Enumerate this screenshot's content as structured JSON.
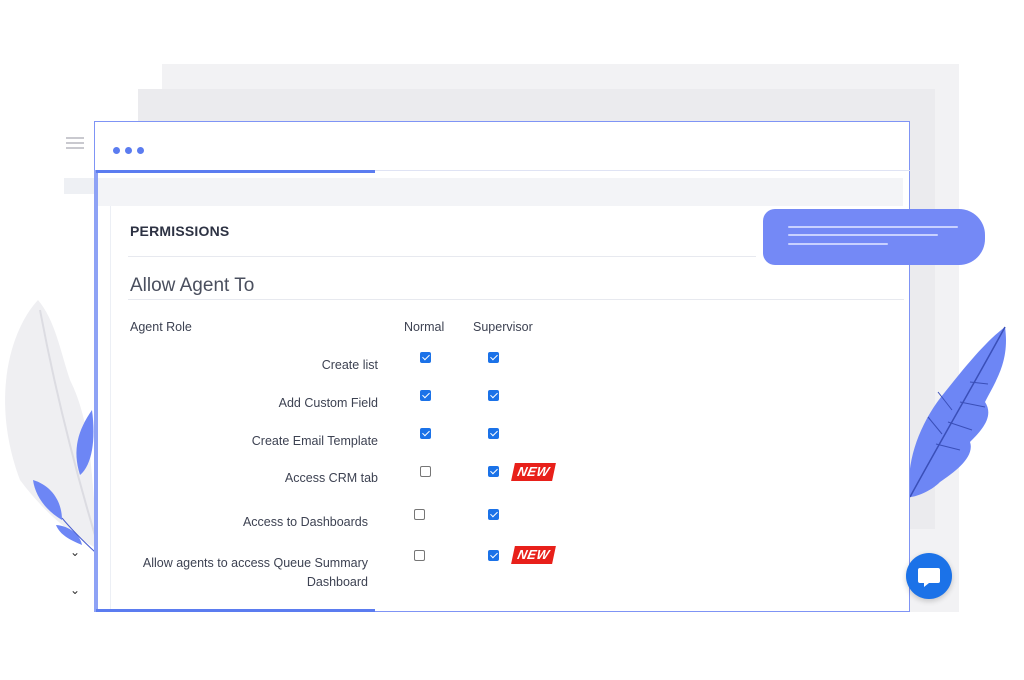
{
  "window": {
    "menu_icon": "ellipsis-icon"
  },
  "sidebar": {
    "menu_icon": "hamburger-icon",
    "chevrons": [
      "⌄",
      "⌄"
    ]
  },
  "section": {
    "title": "PERMISSIONS",
    "subtitle": "Allow Agent To"
  },
  "table": {
    "headers": {
      "role": "Agent Role",
      "normal": "Normal",
      "supervisor": "Supervisor"
    },
    "rows": [
      {
        "label": "Create list",
        "normal": true,
        "supervisor": true,
        "badge": ""
      },
      {
        "label": "Add Custom Field",
        "normal": true,
        "supervisor": true,
        "badge": ""
      },
      {
        "label": "Create Email Template",
        "normal": true,
        "supervisor": true,
        "badge": ""
      },
      {
        "label": "Access CRM tab",
        "normal": false,
        "supervisor": true,
        "badge": "NEW"
      },
      {
        "label": "Access to Dashboards",
        "normal": false,
        "supervisor": true,
        "badge": ""
      },
      {
        "label_line1": "Allow agents to access Queue Summary",
        "label_line2": "Dashboard",
        "normal": false,
        "supervisor": true,
        "badge": "NEW"
      }
    ]
  },
  "colors": {
    "accent": "#5b7cf0",
    "checkbox": "#1b72e8",
    "badge": "#e8201a",
    "pill": "#7489f6"
  },
  "chat": {
    "icon": "chat-bubble-icon"
  }
}
